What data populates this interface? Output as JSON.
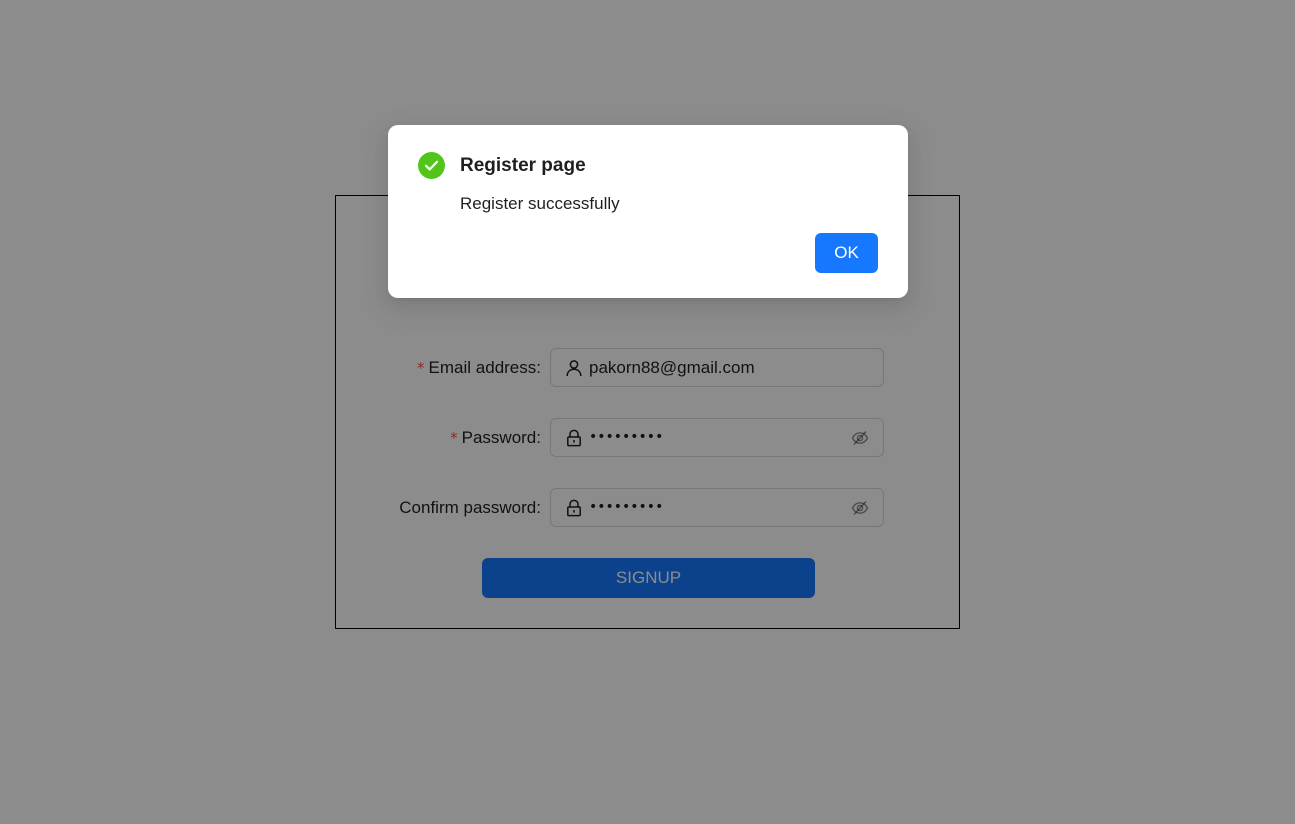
{
  "form": {
    "email_label": "Email address",
    "email_value": "pakorn88@gmail.com",
    "password_label": "Password",
    "password_value": "•••••••••",
    "confirm_label": "Confirm password",
    "confirm_value": "•••••••••",
    "required_mark": "*",
    "label_colon": ":",
    "signup_label": "SIGNUP"
  },
  "modal": {
    "title": "Register page",
    "content": "Register successfully",
    "ok_label": "OK"
  },
  "colors": {
    "primary": "#1677ff",
    "success": "#52c41a",
    "required": "#ff4d4f",
    "mask": "rgba(0,0,0,0.45)"
  },
  "icons": {
    "email_prefix": "user-icon",
    "password_prefix": "lock-icon",
    "password_suffix": "eye-invisible-icon",
    "modal_status": "check-circle-icon"
  }
}
